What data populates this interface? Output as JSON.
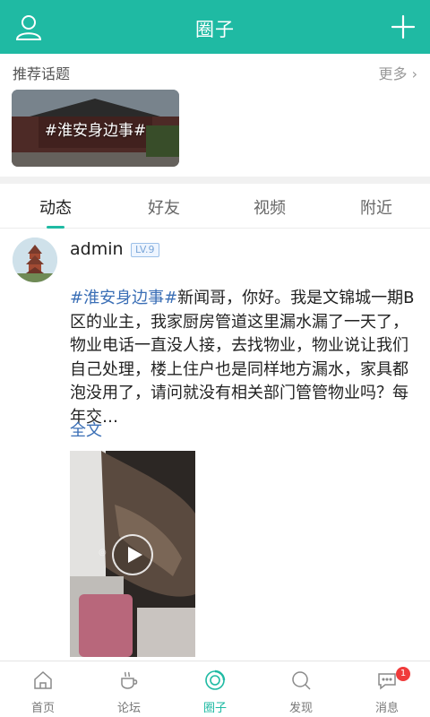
{
  "header": {
    "title": "圈子",
    "left_icon": "user-icon",
    "right_icon": "plus-icon",
    "bg_color": "#1fbaa3"
  },
  "recommended": {
    "label": "推荐话题",
    "more": "更多",
    "topics": [
      {
        "label": "#淮安身边事#"
      }
    ]
  },
  "tabs": [
    "动态",
    "好友",
    "视频",
    "附近"
  ],
  "active_tab": "动态",
  "post": {
    "username": "admin",
    "level": "LV.9",
    "hashtag": "#淮安身边事#",
    "text": "新闻哥，你好。我是文锦城一期B区的业主，我家厨房管道这里漏水漏了一天了，物业电话一直没人接，去找物业，物业说让我们自己处理，楼上住户也是同样地方漏水，家具都泡没用了，请问就没有相关部门管管物业吗？每年交…",
    "full_text_link": "全文"
  },
  "bottom_nav": [
    {
      "label": "首页",
      "icon": "home-icon"
    },
    {
      "label": "论坛",
      "icon": "cup-icon"
    },
    {
      "label": "圈子",
      "icon": "circle-icon"
    },
    {
      "label": "发现",
      "icon": "discover-icon"
    },
    {
      "label": "消息",
      "icon": "message-icon",
      "badge": "1"
    }
  ],
  "active_nav": "圈子",
  "colors": {
    "accent": "#1fbaa3",
    "link": "#3b6fb6",
    "badge": "#f03b3b"
  }
}
